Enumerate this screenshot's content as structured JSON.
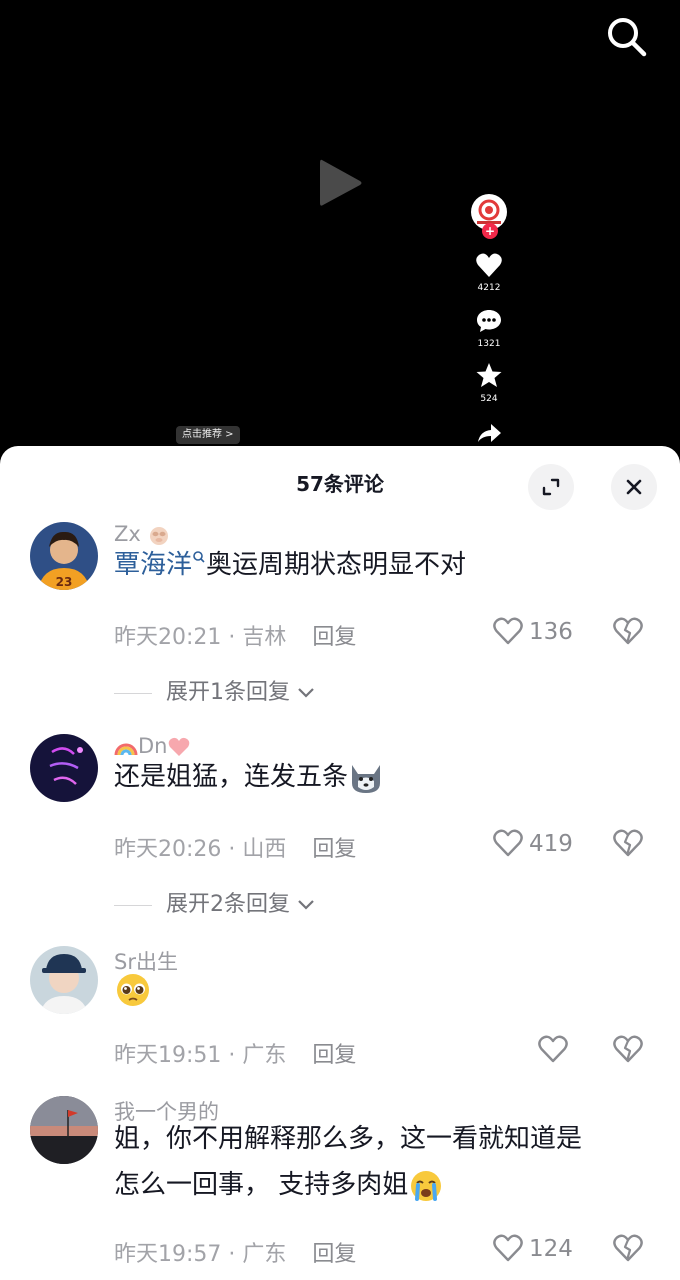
{
  "video": {
    "likes": "4212",
    "comments": "1321",
    "favorites": "524",
    "recommend_chip": "点击推荐 >"
  },
  "sheet": {
    "title": "57条评论"
  },
  "comments": [
    {
      "user": "Zx",
      "mention": "覃海洋",
      "text": "奥运周期状态明显不对",
      "time": "昨天20:21 · 吉林",
      "reply_label": "回复",
      "likes": "136",
      "expand": "展开1条回复"
    },
    {
      "user": "Dn",
      "text": "还是姐猛，连发五条",
      "time": "昨天20:26 · 山西",
      "reply_label": "回复",
      "likes": "419",
      "expand": "展开2条回复"
    },
    {
      "user": "Sr出生",
      "time": "昨天19:51 · 广东",
      "reply_label": "回复"
    },
    {
      "user": "我一个男的",
      "text_line1": "姐，你不用解释那么多，这一看就知道是",
      "text_line2": "怎么一回事， 支持多肉姐",
      "time": "昨天19:57 · 广东",
      "reply_label": "回复",
      "likes": "124"
    }
  ],
  "colors": {
    "background_video": "#000000",
    "sheet": "#ffffff",
    "mention": "#2d5f9a",
    "follow_badge": "#f2294a"
  },
  "icons": [
    "search-icon",
    "play-icon",
    "heart-icon",
    "comment-icon",
    "star-icon",
    "share-icon",
    "expand-icon",
    "close-icon",
    "dislike-icon",
    "chevron-down-icon"
  ]
}
